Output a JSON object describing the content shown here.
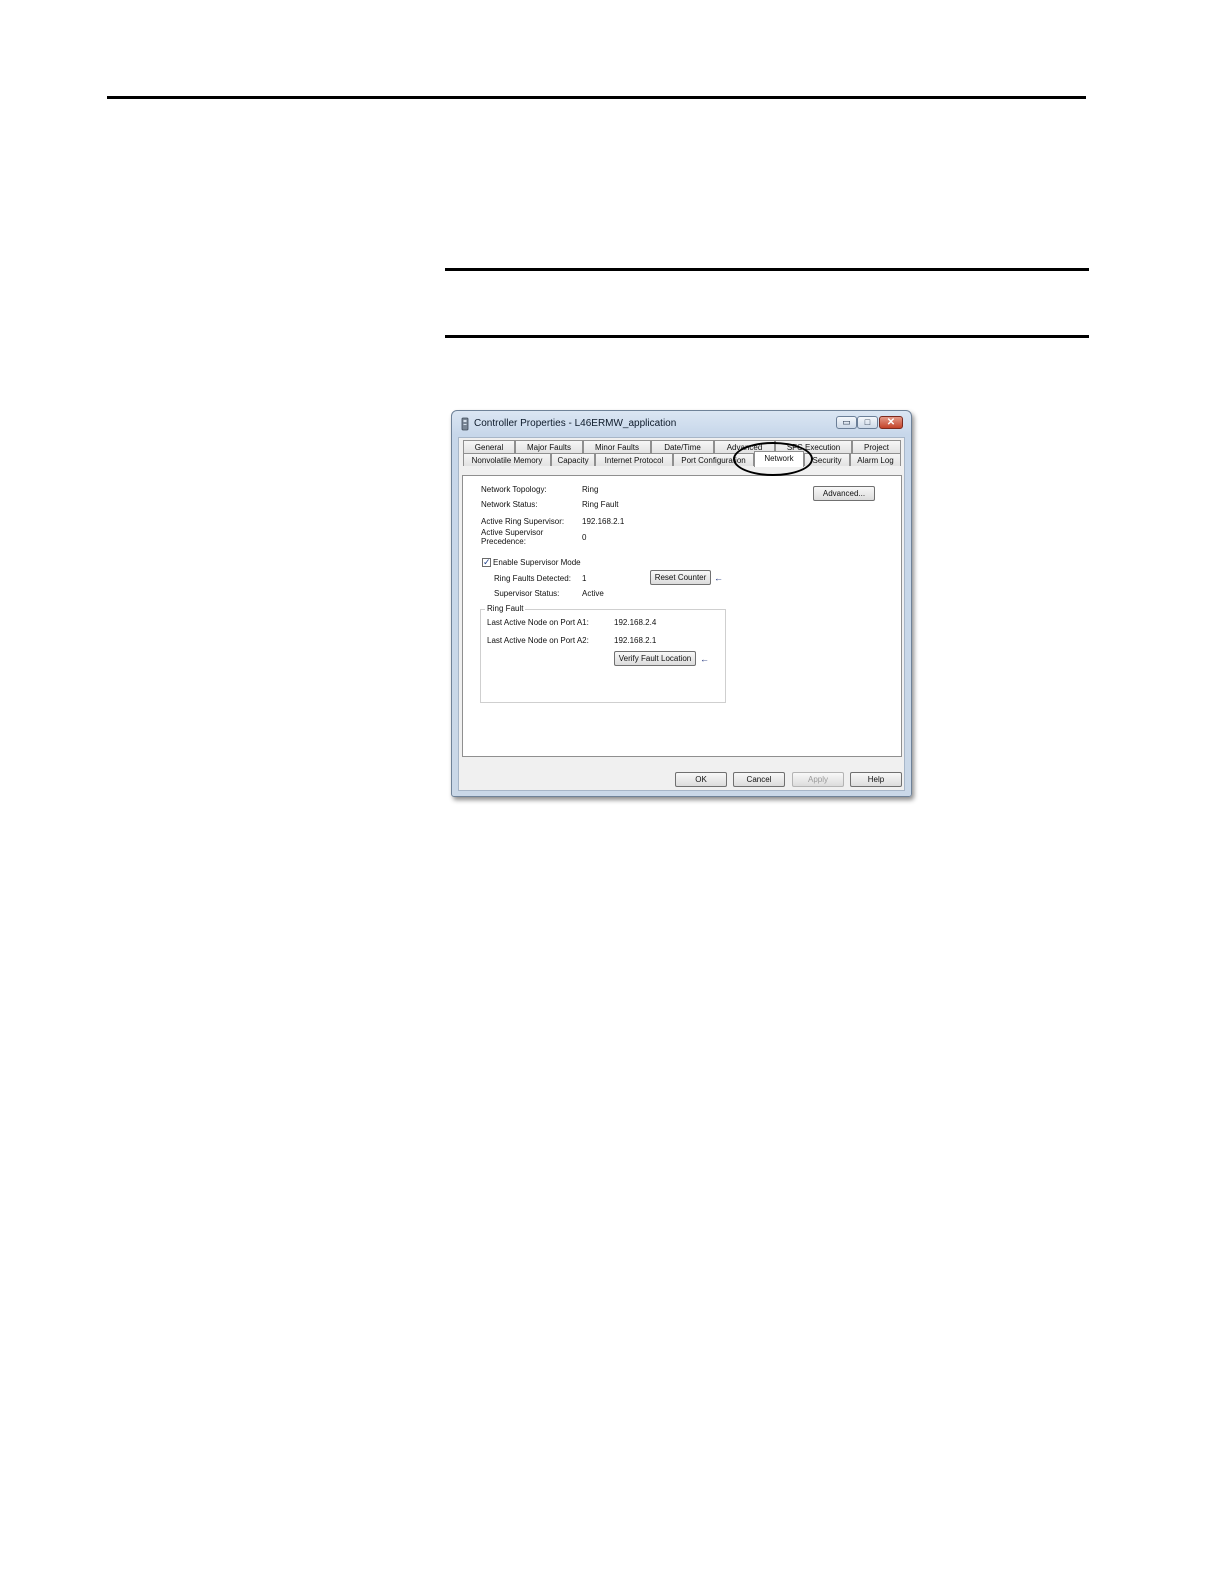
{
  "window": {
    "title": "Controller Properties - L46ERMW_application",
    "minimize_glyph": "▭",
    "maximize_glyph": "□",
    "close_glyph": "✕"
  },
  "tabs": {
    "row_back": [
      "General",
      "Major Faults",
      "Minor Faults",
      "Date/Time",
      "Advanced",
      "SFC Execution",
      "Project"
    ],
    "row_front": [
      "Nonvolatile Memory",
      "Capacity",
      "Internet Protocol",
      "Port Configuration",
      "Network",
      "Security",
      "Alarm Log"
    ],
    "active": "Network"
  },
  "network": {
    "topology_label": "Network Topology:",
    "topology_value": "Ring",
    "status_label": "Network Status:",
    "status_value": "Ring Fault",
    "supervisor_label": "Active Ring Supervisor:",
    "supervisor_value": "192.168.2.1",
    "precedence_label": "Active Supervisor Precedence:",
    "precedence_value": "0",
    "advanced_button": "Advanced...",
    "enable_supervisor_label": "Enable Supervisor Mode",
    "enable_supervisor_checked": true,
    "check_glyph": "✓",
    "ring_faults_label": "Ring Faults Detected:",
    "ring_faults_value": "1",
    "reset_button": "Reset Counter",
    "supervisor_status_label": "Supervisor Status:",
    "supervisor_status_value": "Active"
  },
  "ring_fault": {
    "title": "Ring Fault",
    "port_a1_label": "Last Active Node on Port A1:",
    "port_a1_value": "192.168.2.4",
    "port_a2_label": "Last Active Node on Port A2:",
    "port_a2_value": "192.168.2.1",
    "verify_button": "Verify Fault Location"
  },
  "arrow_glyph": "←",
  "footer": {
    "ok": "OK",
    "cancel": "Cancel",
    "apply": "Apply",
    "help": "Help"
  }
}
